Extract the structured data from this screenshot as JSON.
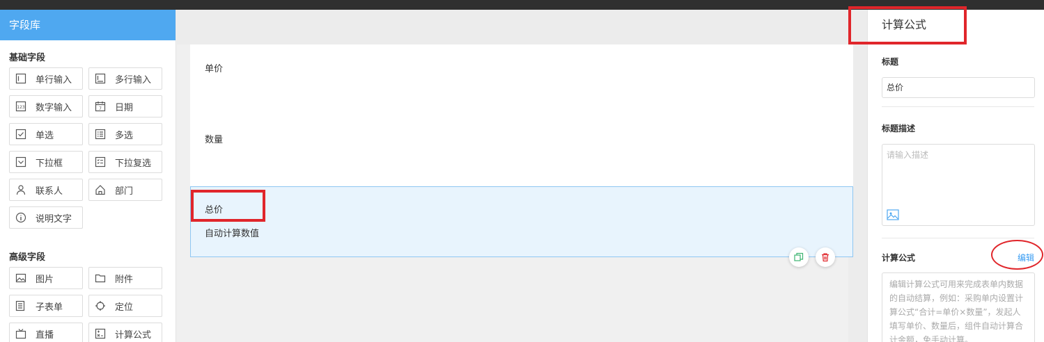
{
  "left_panel": {
    "title": "字段库",
    "basic_title": "基础字段",
    "basic_fields": [
      {
        "label": "单行输入",
        "icon": "text-input-icon"
      },
      {
        "label": "多行输入",
        "icon": "textarea-icon"
      },
      {
        "label": "数字输入",
        "icon": "number-icon"
      },
      {
        "label": "日期",
        "icon": "calendar-icon"
      },
      {
        "label": "单选",
        "icon": "radio-check-icon"
      },
      {
        "label": "多选",
        "icon": "checklist-icon"
      },
      {
        "label": "下拉框",
        "icon": "dropdown-icon"
      },
      {
        "label": "下拉复选",
        "icon": "dropdown-multi-icon"
      },
      {
        "label": "联系人",
        "icon": "person-icon"
      },
      {
        "label": "部门",
        "icon": "home-icon"
      },
      {
        "label": "说明文字",
        "icon": "info-icon"
      }
    ],
    "advanced_title": "高级字段",
    "advanced_fields": [
      {
        "label": "图片",
        "icon": "image-icon"
      },
      {
        "label": "附件",
        "icon": "folder-icon"
      },
      {
        "label": "子表单",
        "icon": "subform-icon"
      },
      {
        "label": "定位",
        "icon": "locate-icon"
      },
      {
        "label": "直播",
        "icon": "live-icon"
      },
      {
        "label": "计算公式",
        "icon": "formula-icon"
      }
    ]
  },
  "form": {
    "fields": [
      {
        "label": "单价",
        "placeholder": ""
      },
      {
        "label": "数量",
        "placeholder": ""
      },
      {
        "label": "总价",
        "placeholder": "自动计算数值"
      }
    ]
  },
  "right_panel": {
    "title": "计算公式",
    "title_label": "标题",
    "title_value": "总价",
    "desc_label": "标题描述",
    "desc_placeholder": "请输入描述",
    "formula_label": "计算公式",
    "edit_link": "编辑",
    "formula_placeholder": "编辑计算公式可用来完成表单内数据的自动结算，例如：采购单内设置计算公式“合计=单价×数量”，发起人填写单价、数量后，组件自动计算合计金额，免手动计算。"
  },
  "colors": {
    "accent": "#4fa8f0",
    "selected_bg": "#e8f4fd",
    "highlight_red": "#e0262b",
    "link": "#3a9df2"
  }
}
